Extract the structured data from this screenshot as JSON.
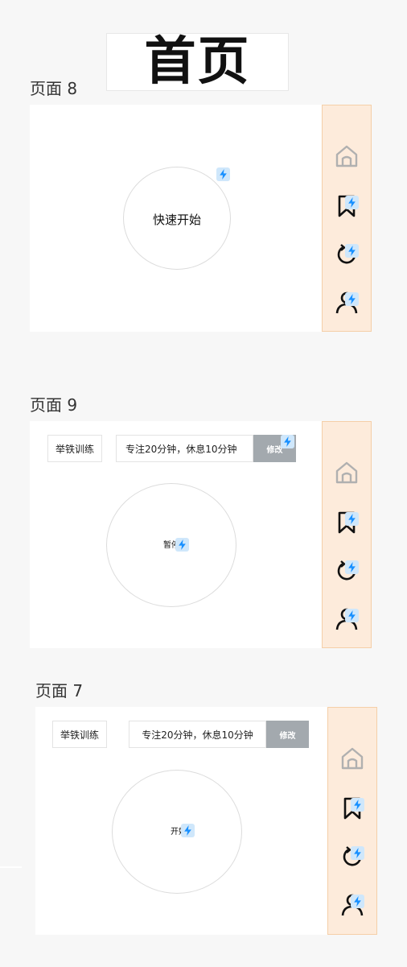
{
  "title": "首页",
  "pages": [
    {
      "label": "页面 8",
      "circle_label": "快速开始"
    },
    {
      "label": "页面 9",
      "tag_label": "举铁训练",
      "focus_text": "专注20分钟，休息10分钟",
      "edit_label": "修改",
      "circle_label": "暂停"
    },
    {
      "label": "页面 7",
      "tag_label": "举铁训练",
      "focus_text": "专注20分钟，休息10分钟",
      "edit_label": "修改",
      "circle_label": "开始"
    }
  ],
  "nav_icons": [
    "home-icon",
    "bookmark-icon",
    "history-icon",
    "profile-icon"
  ],
  "badge_icon": "lightning-bolt-icon",
  "colors": {
    "background": "#f7f7f7",
    "sidebar_bg": "#fdebdb",
    "sidebar_border": "#f5cfa8",
    "badge_bg": "#cfe7fb",
    "badge_bolt": "#1890ff",
    "edit_button": "#a3a9ae"
  }
}
